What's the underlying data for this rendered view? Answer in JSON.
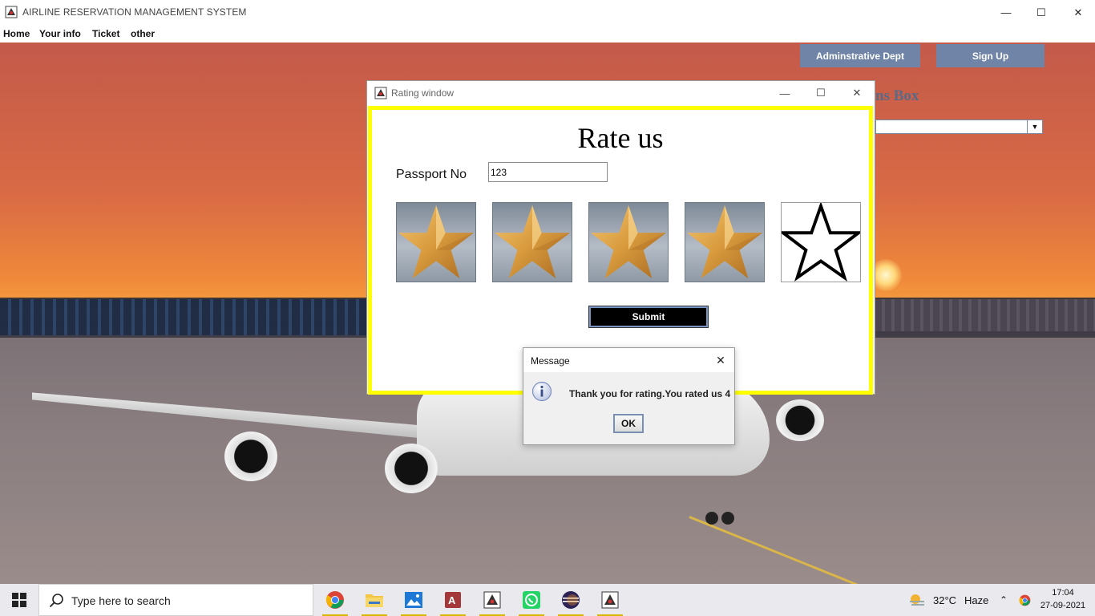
{
  "window": {
    "title": "AIRLINE RESERVATION MANAGEMENT SYSTEM",
    "minimize_glyph": "—",
    "maximize_glyph": "☐",
    "close_glyph": "✕"
  },
  "menu": {
    "items": [
      {
        "label": "Home"
      },
      {
        "label": "Your info"
      },
      {
        "label": "Ticket"
      },
      {
        "label": "other"
      }
    ]
  },
  "background": {
    "admin_button": "Adminstrative Dept",
    "signup_button": "Sign Up",
    "questions_label_partial": "ns Box"
  },
  "rating_window": {
    "title": "Rating window",
    "heading": "Rate us",
    "passport_label": "Passport No",
    "passport_value": "123",
    "stars_total": 5,
    "stars_selected": 4,
    "submit_label": "Submit",
    "minimize_glyph": "—",
    "maximize_glyph": "☐",
    "close_glyph": "✕"
  },
  "message_dialog": {
    "title": "Message",
    "text": "Thank you for rating.You rated us 4",
    "ok_label": "OK",
    "close_glyph": "✕"
  },
  "taskbar": {
    "search_placeholder": "Type here to search",
    "apps": [
      "chrome-icon",
      "file-explorer-icon",
      "photos-icon",
      "access-icon",
      "java-app-icon",
      "whatsapp-icon",
      "eclipse-icon",
      "java-app-icon-2"
    ],
    "weather_temp": "32°C",
    "weather_text": "Haze",
    "time": "17:04",
    "date": "27-09-2021"
  },
  "colors": {
    "highlight_border": "#ffff00",
    "button_blue": "#6f84a6",
    "submit_bg": "#000000",
    "star_gold": "#e0a040"
  }
}
